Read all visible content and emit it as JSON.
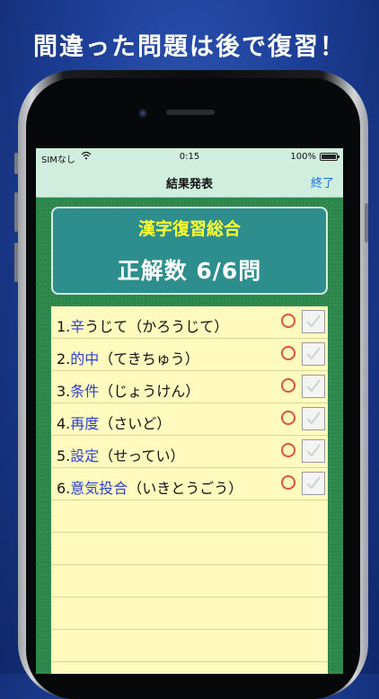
{
  "headline": "間違った問題は後で復習！",
  "status_bar": {
    "carrier": "SIMなし",
    "time": "0:15",
    "battery": "100%"
  },
  "nav": {
    "title": "結果発表",
    "done_label": "終了"
  },
  "score": {
    "title": "漢字復習総合",
    "result": "正解数 6/6問"
  },
  "results": [
    {
      "number": "1.",
      "kanji": "辛",
      "reading": "うじて（かろうじて）",
      "correct": true
    },
    {
      "number": "2.",
      "kanji": "的中",
      "reading": "（てきちゅう）",
      "correct": true
    },
    {
      "number": "3.",
      "kanji": "条件",
      "reading": "（じょうけん）",
      "correct": true
    },
    {
      "number": "4.",
      "kanji": "再度",
      "reading": "（さいど）",
      "correct": true
    },
    {
      "number": "5.",
      "kanji": "設定",
      "reading": "（せってい）",
      "correct": true
    },
    {
      "number": "6.",
      "kanji": "意気投合",
      "reading": "（いきとうごう）",
      "correct": true
    }
  ],
  "colors": {
    "felt": "#2f8a4e",
    "card": "#2e8e8e",
    "score_title": "#ffff33",
    "kanji": "#2b3fd6",
    "circle_mark": "#e0503a",
    "navbar": "#cfeedd",
    "done_link": "#1a6fe0"
  },
  "icons": {
    "correct_mark": "red-circle-icon",
    "checkbox": "checkmark-icon",
    "wifi": "wifi-icon",
    "battery": "battery-icon"
  }
}
